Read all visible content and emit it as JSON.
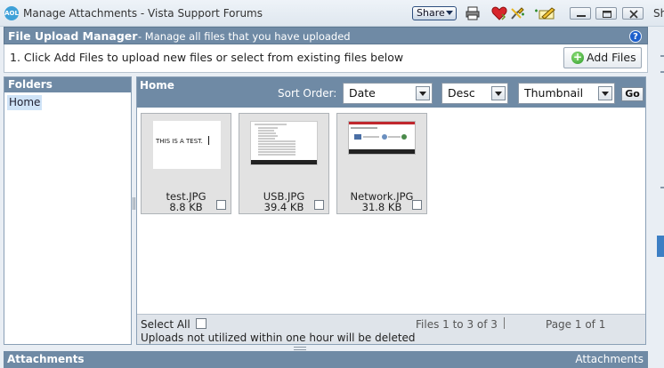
{
  "window": {
    "logo_text": "AOL",
    "title": "Manage Attachments - Vista Support Forums",
    "share_label": "Share",
    "edge_text": "Sh"
  },
  "toolbar_icons": [
    "print-icon",
    "heart-icon",
    "tools-icon",
    "pencil-icon"
  ],
  "window_controls": [
    "minimize",
    "restore",
    "close"
  ],
  "header": {
    "title": "File Upload Manager",
    "subtitle": "- Manage all files that you have uploaded",
    "help_label": "?"
  },
  "instructions": {
    "text": "1. Click Add Files to upload new files or select from existing files below",
    "add_files_label": "Add Files"
  },
  "folders": {
    "title": "Folders",
    "items": [
      {
        "label": "Home",
        "selected": true
      }
    ]
  },
  "main": {
    "title": "Home",
    "sort_label": "Sort Order:",
    "sort_field": "Date",
    "sort_direction": "Desc",
    "view_mode": "Thumbnail",
    "go_label": "Go",
    "files": [
      {
        "name": "test.JPG",
        "size": "8.8 KB",
        "thumb_text": "THIS IS A TEST."
      },
      {
        "name": "USB.JPG",
        "size": "39.4 KB"
      },
      {
        "name": "Network.JPG",
        "size": "31.8 KB"
      }
    ],
    "footer": {
      "select_all_label": "Select All",
      "files_count": "Files 1 to 3 of 3",
      "page_info": "Page 1 of 1",
      "note": "Uploads not utilized within one hour will be deleted"
    }
  },
  "attachments_bar": {
    "left_label": "Attachments",
    "right_label": "Attachments"
  },
  "colors": {
    "panel_header": "#6f8aa5",
    "folder_selected": "#cfe3f7",
    "tile_bg": "#e2e2e2",
    "help_blue": "#1c5fcc",
    "add_green": "#2e9a2a"
  }
}
